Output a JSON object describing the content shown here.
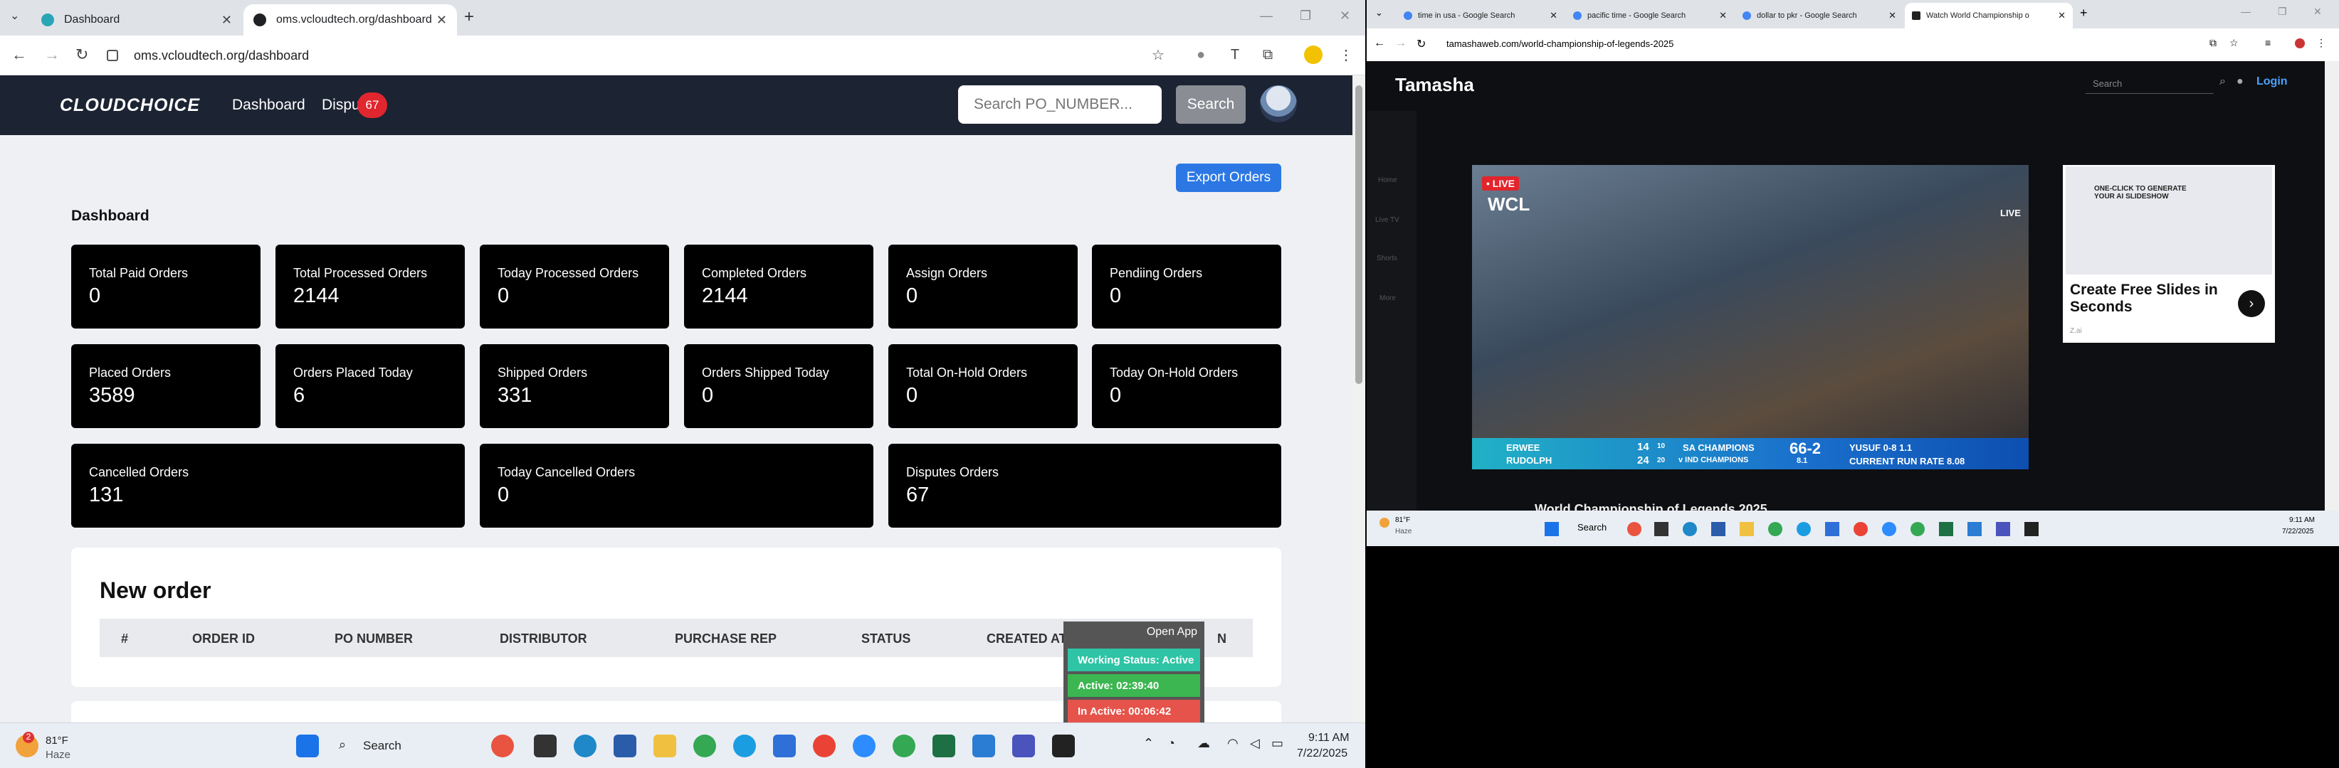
{
  "left_browser": {
    "tabs": [
      {
        "title": "Dashboard"
      },
      {
        "title": "oms.vcloudtech.org/dashboard"
      }
    ],
    "url": "oms.vcloudtech.org/dashboard"
  },
  "app": {
    "logo": "CLOUDCHOICE",
    "nav": {
      "dashboard": "Dashboard",
      "disputes": "Dispu",
      "disputes_badge": "67"
    },
    "search": {
      "placeholder": "Search PO_NUMBER...",
      "button": "Search"
    },
    "export_button": "Export Orders",
    "dashboard_title": "Dashboard",
    "cards": [
      {
        "label": "Total Paid Orders",
        "value": "0"
      },
      {
        "label": "Total Processed Orders",
        "value": "2144"
      },
      {
        "label": "Today Processed Orders",
        "value": "0"
      },
      {
        "label": "Completed Orders",
        "value": "2144"
      },
      {
        "label": "Assign Orders",
        "value": "0"
      },
      {
        "label": "Pendiing Orders",
        "value": "0"
      },
      {
        "label": "Placed Orders",
        "value": "3589"
      },
      {
        "label": "Orders Placed Today",
        "value": "6"
      },
      {
        "label": "Shipped Orders",
        "value": "331"
      },
      {
        "label": "Orders Shipped Today",
        "value": "0"
      },
      {
        "label": "Total On-Hold Orders",
        "value": "0"
      },
      {
        "label": "Today On-Hold Orders",
        "value": "0"
      },
      {
        "label": "Cancelled Orders",
        "value": "131"
      },
      {
        "label": "Today Cancelled Orders",
        "value": "0"
      },
      {
        "label": "Disputes Orders",
        "value": "67"
      }
    ],
    "new_order": {
      "title": "New order",
      "columns": [
        "#",
        "ORDER ID",
        "PO NUMBER",
        "DISTRIBUTOR",
        "PURCHASE REP",
        "STATUS",
        "CREATED AT",
        "N"
      ]
    },
    "status_widget": {
      "open_app": "Open App",
      "working_status": "Working Status: Active",
      "active": "Active: 02:39:40",
      "inactive": "In Active: 00:06:42",
      "colors": {
        "working": "#2ec4a5",
        "active": "#3cb651",
        "inactive": "#e5534b"
      }
    }
  },
  "left_taskbar": {
    "weather_temp": "81°F",
    "weather_desc": "Haze",
    "weather_badge": "2",
    "search": "Search",
    "time": "9:11 AM",
    "date": "7/22/2025"
  },
  "right_browser": {
    "tabs": [
      {
        "title": "time in usa - Google Search"
      },
      {
        "title": "pacific time - Google Search"
      },
      {
        "title": "dollar to pkr - Google Search"
      },
      {
        "title": "Watch World Championship o"
      }
    ],
    "url": "tamashaweb.com/world-championship-of-legends-2025",
    "site": {
      "logo": "Tamasha",
      "search_placeholder": "Search",
      "login": "Login",
      "side": [
        "Home",
        "Live TV",
        "Shorts",
        "More"
      ],
      "video": {
        "live_badge": "• LIVE",
        "corner_live": "LIVE",
        "league": "WCL",
        "batter1": "ERWEE",
        "batter1_runs": "14",
        "batter1_balls": "10",
        "batter2": "RUDOLPH",
        "batter2_runs": "24",
        "batter2_balls": "20",
        "team": "SA CHAMPIONS",
        "team_sub": "v IND CHAMPIONS",
        "score": "66-2",
        "overs": "8.1",
        "bowler": "YUSUF 0-8 1.1",
        "run_rate": "CURRENT RUN RATE 8.08"
      },
      "ad": {
        "banner": "ONE-CLICK TO GENERATE YOUR AI SLIDESHOW",
        "title": "Create Free Slides in Seconds",
        "brand": "Z.ai"
      },
      "below_title": "World Championship of Legends 2025"
    }
  },
  "right_taskbar": {
    "weather_temp": "81°F",
    "weather_desc": "Haze",
    "search": "Search",
    "time": "9:11 AM",
    "date": "7/22/2025"
  }
}
